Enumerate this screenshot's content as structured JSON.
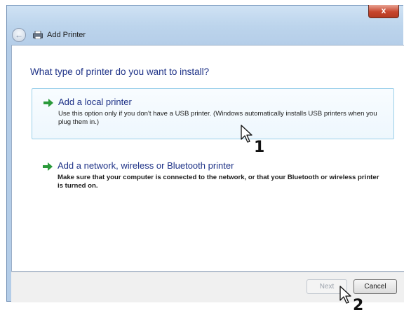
{
  "window": {
    "title": "Add Printer",
    "close_label": "x"
  },
  "content": {
    "question": "What type of printer do you want to install?",
    "options": [
      {
        "heading": "Add a local printer",
        "description": "Use this option only if you don't have a USB printer. (Windows automatically installs USB printers when you plug them in.)"
      },
      {
        "heading": "Add a network, wireless or Bluetooth printer",
        "description": "Make sure that your computer is connected to the network, or that your Bluetooth or wireless printer is turned on."
      }
    ]
  },
  "footer": {
    "next_label": "Next",
    "cancel_label": "Cancel"
  },
  "callouts": [
    "1",
    "2"
  ],
  "colors": {
    "link_blue": "#1e3287",
    "arrow_green": "#2a9a3a",
    "selected_border": "#9bd0ea"
  },
  "icons": [
    "close-icon",
    "back-arrow-icon",
    "printer-icon",
    "green-arrow-icon",
    "mouse-cursor-icon"
  ]
}
